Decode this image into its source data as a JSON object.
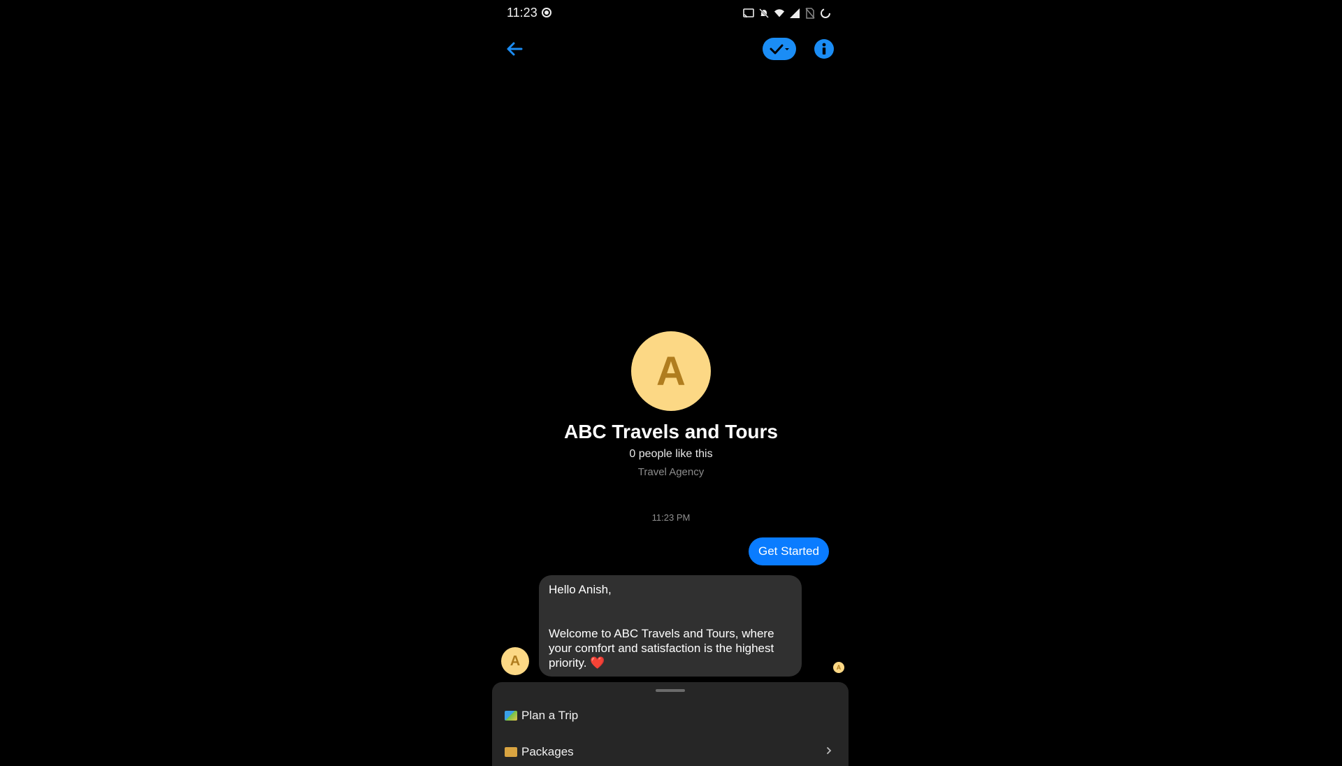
{
  "status_bar": {
    "time": "11:23",
    "icons": [
      "cast-icon",
      "mute-bell-icon",
      "wifi-icon",
      "signal-icon",
      "no-sim-icon",
      "loading-icon"
    ]
  },
  "header": {
    "back_icon": "back-arrow-icon",
    "verified_icon": "check-dropdown-icon",
    "info_icon": "info-icon"
  },
  "profile": {
    "avatar_letter": "A",
    "name": "ABC Travels and Tours",
    "likes": "0 people like this",
    "category": "Travel Agency"
  },
  "conversation": {
    "timestamp": "11:23 PM",
    "user_message": "Get Started",
    "bot_message": {
      "line1": "Hello Anish,",
      "line2": "Welcome to ABC Travels and Tours, where your comfort and satisfaction is the highest priority. ❤️"
    },
    "bot_avatar_letter": "A",
    "seen_avatar_letter": "A"
  },
  "menu": {
    "items": [
      {
        "label": "Plan a Trip",
        "icon": "map-emoji-icon"
      },
      {
        "label": "Packages",
        "icon": "package-emoji-icon"
      }
    ]
  },
  "colors": {
    "accent": "#0a7cff",
    "avatar_bg": "#fcd885",
    "avatar_fg": "#b07d1f",
    "bubble_bg": "#303030",
    "sheet_bg": "#262626"
  }
}
